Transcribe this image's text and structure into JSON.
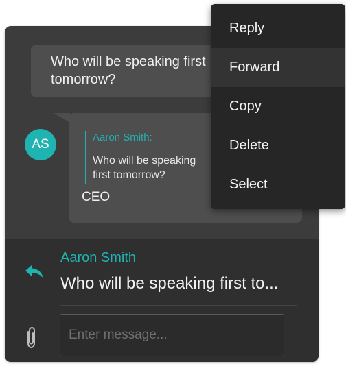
{
  "chat": {
    "outgoing": {
      "text": "Who will be speaking first tomorrow?"
    },
    "incoming": {
      "avatar_initials": "AS",
      "quote_author": "Aaron Smith:",
      "quote_text": "Who will be speaking first tomorrow?",
      "text": "CEO"
    }
  },
  "reply_preview": {
    "icon": "reply-arrow-icon",
    "author": "Aaron Smith",
    "text": "Who will be speaking first to..."
  },
  "composer": {
    "attach_icon": "paperclip-icon",
    "placeholder": "Enter message..."
  },
  "context_menu": {
    "items": [
      {
        "label": "Reply"
      },
      {
        "label": "Forward",
        "highlighted": true
      },
      {
        "label": "Copy"
      },
      {
        "label": "Delete"
      },
      {
        "label": "Select"
      }
    ]
  },
  "colors": {
    "accent": "#1fb3b1",
    "panel": "#3c3c3c",
    "bubble": "#4e4e4e",
    "menu": "#262626"
  }
}
